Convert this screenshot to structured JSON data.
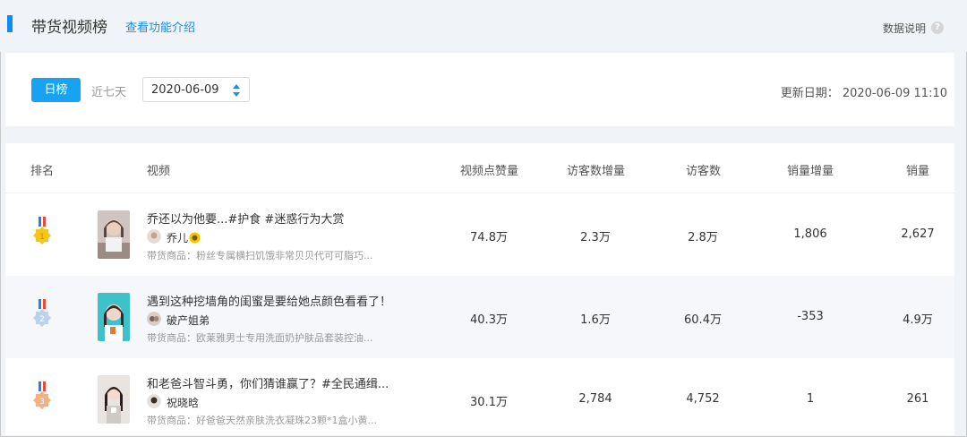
{
  "header": {
    "title": "带货视频榜",
    "intro_link": "查看功能介绍",
    "data_desc": "数据说明",
    "help_glyph": "?"
  },
  "filters": {
    "tab_daily": "日榜",
    "tab_week": "近七天",
    "date": "2020-06-09",
    "update_label": "更新日期：",
    "update_value": "2020-06-09 11:10"
  },
  "table": {
    "columns": [
      "排名",
      "视频",
      "视频点赞量",
      "访客数增量",
      "访客数",
      "销量增量",
      "销量"
    ],
    "rows": [
      {
        "rank": "1",
        "title": "乔还以为他要...#护食 #迷惑行为大赏",
        "author": "乔儿",
        "goods": "带货商品：粉丝专属横扫饥饿非常贝贝代可可脂巧...",
        "likes": "74.8万",
        "visitor_increase": "2.3万",
        "visitors": "2.8万",
        "sales_increase": "1,806",
        "sales": "2,627"
      },
      {
        "rank": "2",
        "title": "遇到这种挖墙角的闺蜜是要给她点颜色看看了！",
        "author": "破产姐弟",
        "goods": "带货商品：欧莱雅男士专用洗面奶护肤品套装控油...",
        "likes": "40.3万",
        "visitor_increase": "1.6万",
        "visitors": "60.4万",
        "sales_increase": "-353",
        "sales": "4.9万"
      },
      {
        "rank": "3",
        "title": "和老爸斗智斗勇，你们猜谁赢了？#全民通缉...",
        "author": "祝晓晗",
        "goods": "带货商品：好爸爸天然亲肤洗衣凝珠23颗*1盒小黄...",
        "likes": "30.1万",
        "visitor_increase": "2,784",
        "visitors": "4,752",
        "sales_increase": "1",
        "sales": "261"
      }
    ]
  },
  "colors": {
    "accent": "#0a8ef5",
    "tab_active": "#17a3f1",
    "link": "#1a8ee8",
    "medal_gold": "#f5c518",
    "medal_silver": "#b9d3ec",
    "medal_bronze": "#f2b083"
  },
  "icons": {
    "medal": "medal-icon",
    "sort": "sort-arrows-icon",
    "help": "question-icon",
    "badge": "sun-badge-icon"
  }
}
